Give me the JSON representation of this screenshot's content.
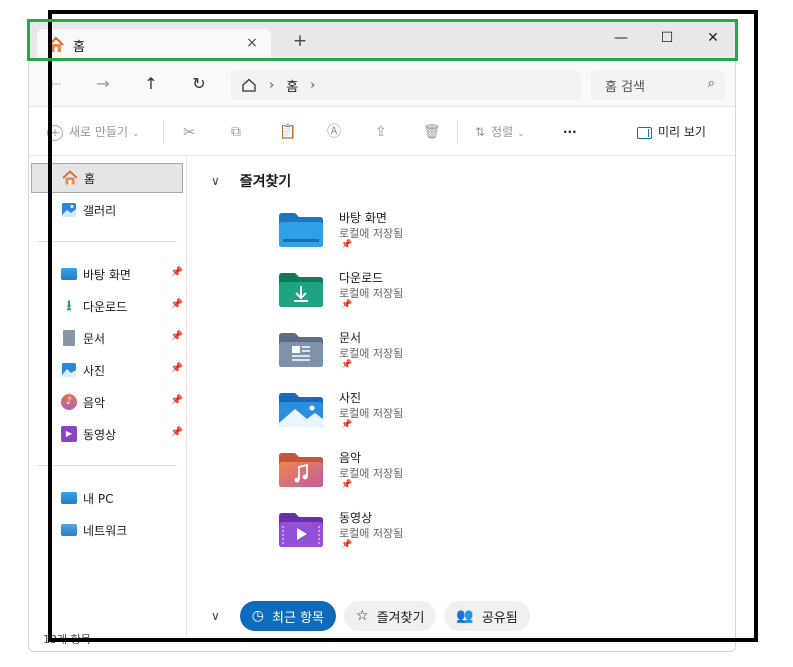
{
  "window": {
    "tab_title": "홈",
    "tab_close": "×",
    "new_tab": "+",
    "minimize": "—",
    "maximize": "☐",
    "close": "✕"
  },
  "nav": {
    "back": "←",
    "forward": "→",
    "up": "↑",
    "refresh": "↻",
    "breadcrumb": [
      "홈"
    ],
    "search_placeholder": "홈 검색"
  },
  "commands": {
    "new": "새로 만들기",
    "sort": "정렬",
    "more": "···",
    "preview": "미리 보기"
  },
  "sidebar": {
    "home": "홈",
    "gallery": "갤러리",
    "pinned": [
      {
        "label": "바탕 화면",
        "icon": "desktop-icon"
      },
      {
        "label": "다운로드",
        "icon": "downloads-icon"
      },
      {
        "label": "문서",
        "icon": "documents-icon"
      },
      {
        "label": "사진",
        "icon": "pictures-icon"
      },
      {
        "label": "음악",
        "icon": "music-icon"
      },
      {
        "label": "동영상",
        "icon": "videos-icon"
      }
    ],
    "this_pc": "내 PC",
    "network": "네트워크"
  },
  "main": {
    "favorites_header": "즐겨찾기",
    "items": [
      {
        "name": "바탕 화면",
        "sub": "로컬에 저장됨",
        "color": "#1e8fd6"
      },
      {
        "name": "다운로드",
        "sub": "로컬에 저장됨",
        "color": "#1a9c78"
      },
      {
        "name": "문서",
        "sub": "로컬에 저장됨",
        "color": "#7a8ca6"
      },
      {
        "name": "사진",
        "sub": "로컬에 저장됨",
        "color": "#2b88d8"
      },
      {
        "name": "음악",
        "sub": "로컬에 저장됨",
        "color": "#e2774a"
      },
      {
        "name": "동영상",
        "sub": "로컬에 저장됨",
        "color": "#8a45c6"
      }
    ],
    "pills": {
      "recent": "최근 항목",
      "favorites": "즐겨찾기",
      "shared": "공유됨"
    }
  },
  "status": {
    "count": "13개 항목"
  }
}
